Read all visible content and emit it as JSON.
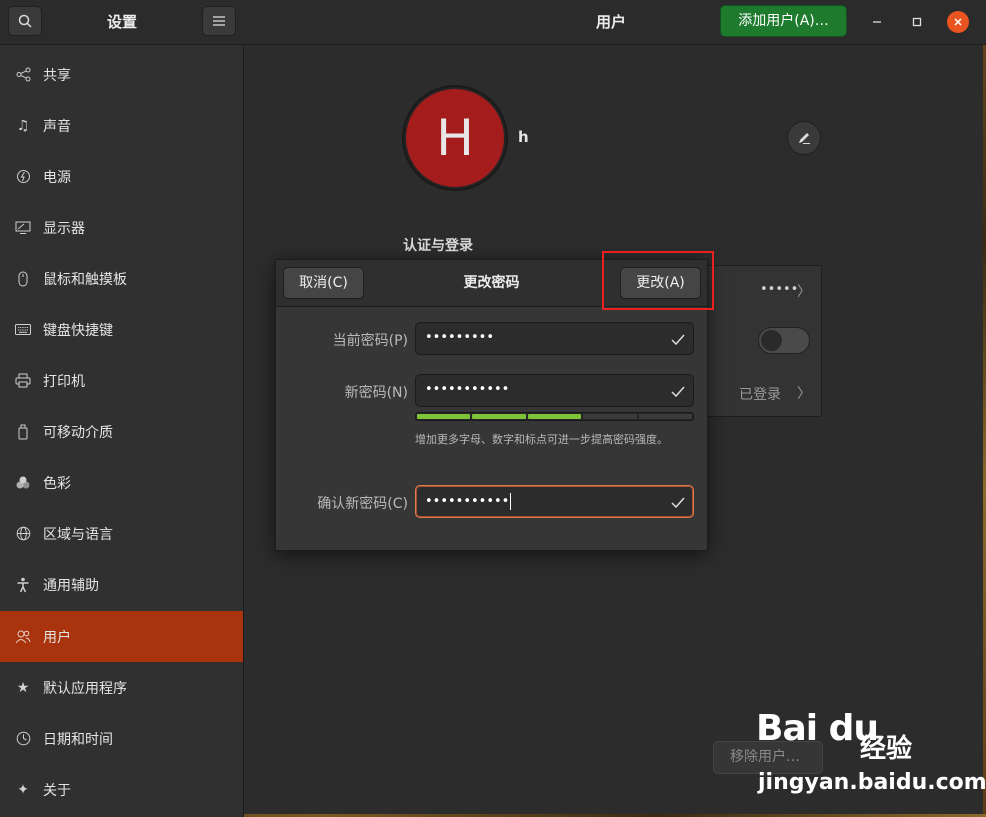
{
  "sidebar": {
    "title": "设置",
    "items": [
      {
        "label": "共享",
        "icon": "share-icon"
      },
      {
        "label": "声音",
        "icon": "music-note-icon"
      },
      {
        "label": "电源",
        "icon": "power-icon"
      },
      {
        "label": "显示器",
        "icon": "display-icon"
      },
      {
        "label": "鼠标和触摸板",
        "icon": "mouse-icon"
      },
      {
        "label": "键盘快捷键",
        "icon": "keyboard-icon"
      },
      {
        "label": "打印机",
        "icon": "printer-icon"
      },
      {
        "label": "可移动介质",
        "icon": "removable-media-icon"
      },
      {
        "label": "色彩",
        "icon": "color-icon"
      },
      {
        "label": "区域与语言",
        "icon": "globe-icon"
      },
      {
        "label": "通用辅助",
        "icon": "accessibility-icon"
      },
      {
        "label": "用户",
        "icon": "users-icon",
        "active": true
      },
      {
        "label": "默认应用程序",
        "icon": "star-icon"
      },
      {
        "label": "日期和时间",
        "icon": "clock-icon"
      },
      {
        "label": "关于",
        "icon": "sparkle-icon"
      }
    ]
  },
  "header": {
    "title": "用户",
    "add_user_label": "添加用户(A)…"
  },
  "user": {
    "avatar_letter": "H",
    "name": "h"
  },
  "auth_section": {
    "title": "认证与登录",
    "password_mask": "•••••",
    "logged_in_label": "已登录"
  },
  "remove_button_label": "移除用户…",
  "dialog": {
    "title": "更改密码",
    "cancel_label": "取消(C)",
    "change_label": "更改(A)",
    "current_password_label": "当前密码(P)",
    "current_password_value": "•••••••••",
    "new_password_label": "新密码(N)",
    "new_password_value": "•••••••••••",
    "confirm_password_label": "确认新密码(C)",
    "confirm_password_value": "•••••••••••",
    "strength_hint": "增加更多字母、数字和标点可进一步提高密码强度。",
    "strength_level": 0.6
  },
  "watermark": {
    "logo": "Bai du",
    "cn": "经验",
    "url": "jingyan.baidu.com"
  },
  "colors": {
    "accent": "#a8330d",
    "add_button": "#1e7a2d",
    "avatar": "#a51c1c",
    "strength": "#7ec338",
    "highlight_box": "#e8201f",
    "close_button": "#e95420"
  }
}
